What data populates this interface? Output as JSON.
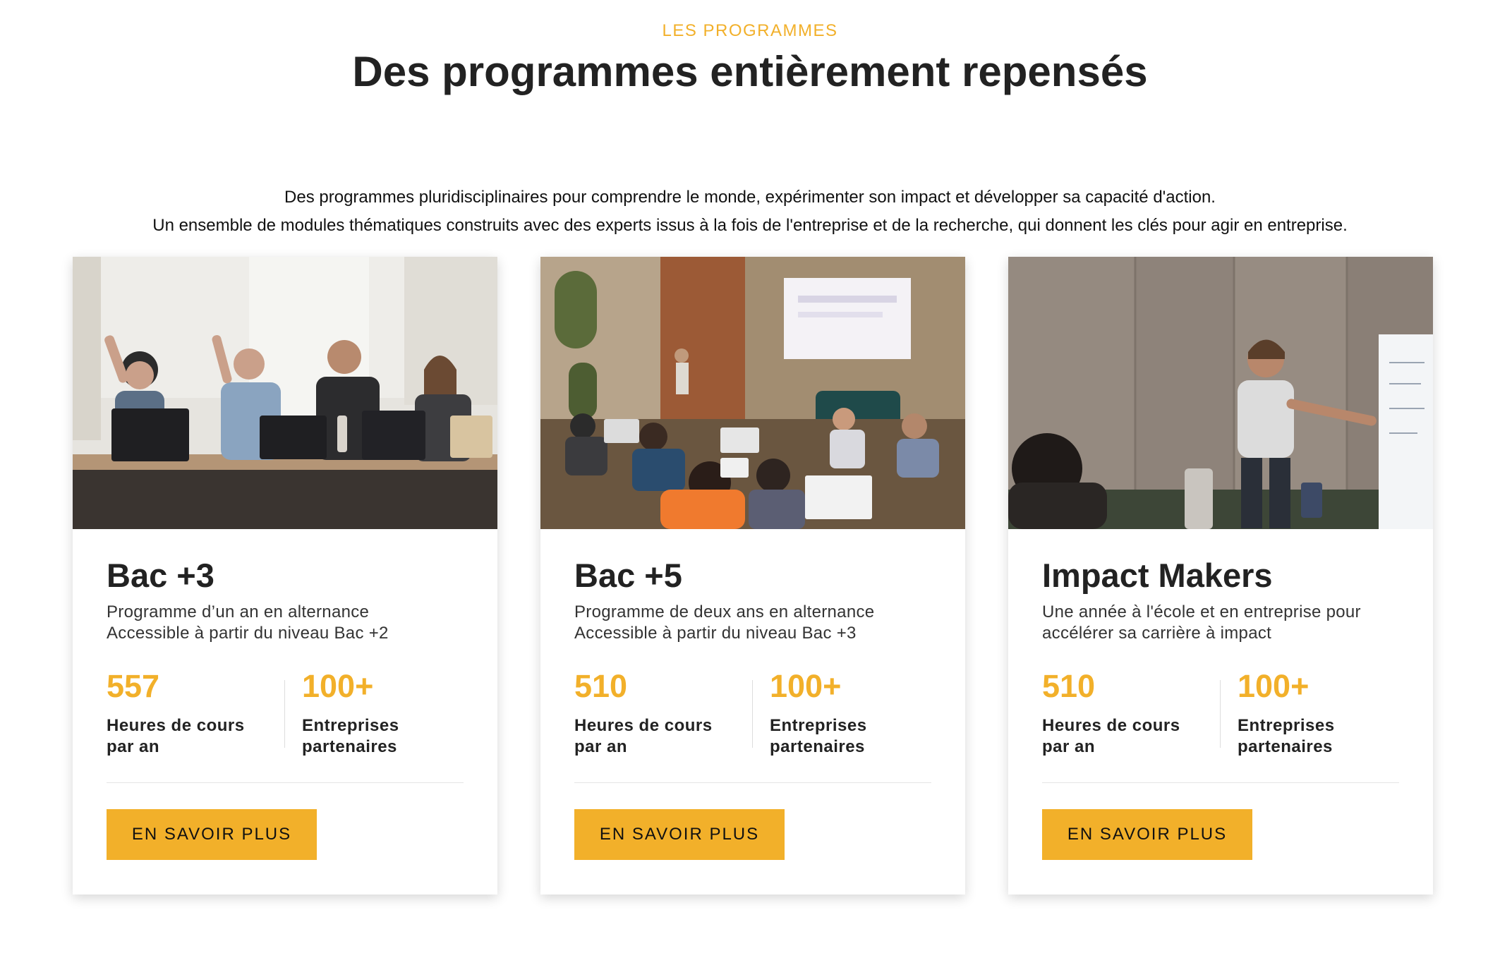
{
  "header": {
    "eyebrow": "LES PROGRAMMES",
    "title": "Des programmes entièrement repensés",
    "intro_line1": "Des programmes pluridisciplinaires pour comprendre le monde, expérimenter son impact et développer sa capacité d'action.",
    "intro_line2": "Un ensemble de modules thématiques construits avec des experts issus à la fois de l'entreprise et de la recherche, qui donnent les clés pour agir en entreprise."
  },
  "colors": {
    "accent": "#f2b02a",
    "text": "#222222"
  },
  "programs": [
    {
      "title": "Bac +3",
      "desc_line1": "Programme d’un an en alternance",
      "desc_line2": "Accessible à partir du niveau Bac +2",
      "stat1_value": "557",
      "stat1_label": "Heures de cours par an",
      "stat2_value": "100+",
      "stat2_label": "Entreprises partenaires",
      "cta": "EN SAVOIR PLUS"
    },
    {
      "title": "Bac +5",
      "desc_line1": "Programme de deux ans en alternance",
      "desc_line2": "Accessible à partir du niveau Bac +3",
      "stat1_value": "510",
      "stat1_label": "Heures de cours par an",
      "stat2_value": "100+",
      "stat2_label": "Entreprises partenaires",
      "cta": "EN SAVOIR PLUS"
    },
    {
      "title": "Impact Makers",
      "desc_line1": "Une année à l'école et en entreprise pour",
      "desc_line2": "accélérer sa carrière à impact",
      "stat1_value": "510",
      "stat1_label": "Heures de cours par an",
      "stat2_value": "100+",
      "stat2_label": "Entreprises partenaires",
      "cta": "EN SAVOIR PLUS"
    }
  ]
}
